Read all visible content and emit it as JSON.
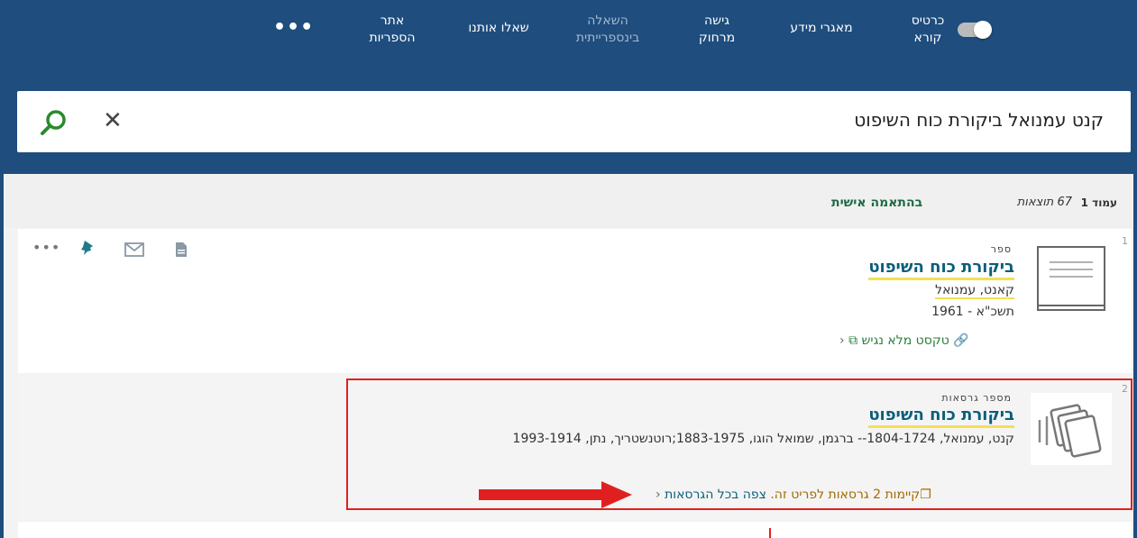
{
  "nav": {
    "items": [
      {
        "id": "card",
        "line1": "כרטיס",
        "line2": "קורא",
        "dim": false
      },
      {
        "id": "db",
        "line1": "מאגרי מידע",
        "line2": "",
        "dim": false
      },
      {
        "id": "remote",
        "line1": "גישה",
        "line2": "מרחוק",
        "dim": false
      },
      {
        "id": "ill",
        "line1": "השאלה",
        "line2": "בינספרייתית",
        "dim": true
      },
      {
        "id": "ask",
        "line1": "שאלו אותנו",
        "line2": "",
        "dim": false
      },
      {
        "id": "site",
        "line1": "אתר",
        "line2": "הספריות",
        "dim": false
      }
    ],
    "more": "•••"
  },
  "search": {
    "query": "קנט עמנואל  ביקורת כוח השיפוט",
    "clear_symbol": "✕"
  },
  "results_header": {
    "page_label": "עמוד 1",
    "count_label": "67 תוצאות",
    "personalized_label": "בהתאמה אישית"
  },
  "results": [
    {
      "index": "1",
      "type": "ספר",
      "title": "ביקורת כוח השיפוט",
      "author": "קאנט, עמנואל",
      "date": "תשכ\"א - 1961",
      "link": "טקסט מלא נגיש",
      "more": "•••"
    },
    {
      "index": "2",
      "type": "מספר גרסאות",
      "title": "ביקורת כוח השיפוט",
      "authors": "קנט, עמנואל, 1804-1724-- ברגמן, שמואל הוגו, 1883-1975;רוטנשטריך, נתן, 1993-1914",
      "versions_text": "קיימות 2 גרסאות לפריט זה.",
      "versions_link": "צפה בכל הגרסאות"
    }
  ],
  "colors": {
    "nav_bg": "#1e4d7e",
    "title_link": "#0b5e7a",
    "highlight": "#f3e054",
    "annotation_red": "#e02020",
    "green": "#2a7d3c"
  }
}
